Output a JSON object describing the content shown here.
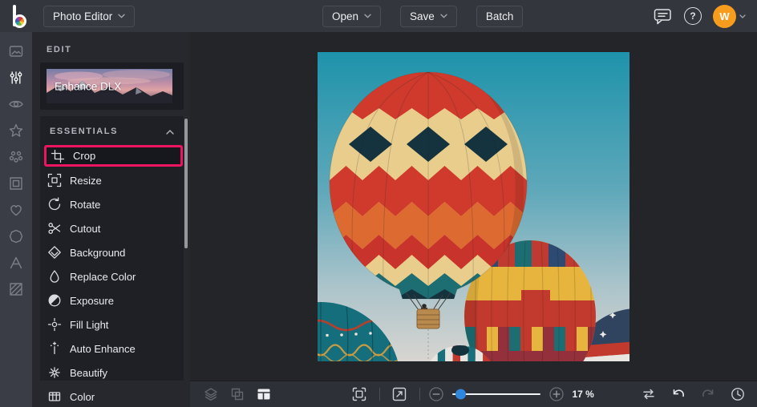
{
  "topbar": {
    "app_menu_label": "Photo Editor",
    "open_label": "Open",
    "save_label": "Save",
    "batch_label": "Batch",
    "help_glyph": "?",
    "avatar_initial": "W",
    "icons": [
      "befunky-logo",
      "chevron-down-icon",
      "chat-feedback-icon",
      "help-icon",
      "avatar"
    ]
  },
  "left_rail": {
    "icons": [
      "photo-manager-icon",
      "edit-adjust-icon",
      "touch-up-icon",
      "effects-star-icon",
      "artsy-icon",
      "frames-icon",
      "overlays-heart-icon",
      "graphics-badge-icon",
      "text-tool-icon",
      "textures-icon"
    ],
    "active_index": 1
  },
  "panel": {
    "section_label": "EDIT",
    "enhance_card_label": "Enhance DLX",
    "essentials_label": "ESSENTIALS",
    "items": [
      {
        "label": "Crop",
        "icon": "crop-icon",
        "active": true
      },
      {
        "label": "Resize",
        "icon": "resize-icon",
        "active": false
      },
      {
        "label": "Rotate",
        "icon": "rotate-icon",
        "active": false
      },
      {
        "label": "Cutout",
        "icon": "scissors-icon",
        "active": false
      },
      {
        "label": "Background",
        "icon": "background-diamond-icon",
        "active": false
      },
      {
        "label": "Replace Color",
        "icon": "droplet-icon",
        "active": false
      },
      {
        "label": "Exposure",
        "icon": "exposure-icon",
        "active": false
      },
      {
        "label": "Fill Light",
        "icon": "fill-light-icon",
        "active": false
      },
      {
        "label": "Auto Enhance",
        "icon": "auto-enhance-wand-icon",
        "active": false
      },
      {
        "label": "Beautify",
        "icon": "beautify-flower-icon",
        "active": false
      },
      {
        "label": "Color",
        "icon": "color-swatch-icon",
        "active": false
      }
    ]
  },
  "canvas": {
    "image_description": "Colorful hot air balloons against a teal sky"
  },
  "bottombar": {
    "zoom_percent": "17 %",
    "icons": [
      "layers-icon",
      "transform-icon",
      "panel-layout-icon",
      "fit-screen-icon",
      "fullscreen-preview-icon",
      "zoom-out-icon",
      "zoom-slider",
      "zoom-in-icon",
      "compare-icon",
      "undo-icon",
      "redo-icon",
      "history-icon"
    ]
  },
  "colors": {
    "accent_pink": "#ed155f",
    "avatar_orange": "#f79c1d",
    "slider_blue": "#2f86de",
    "topbar_bg": "#34363e",
    "panel_bg": "#26282e",
    "canvas_bg": "#242528"
  }
}
